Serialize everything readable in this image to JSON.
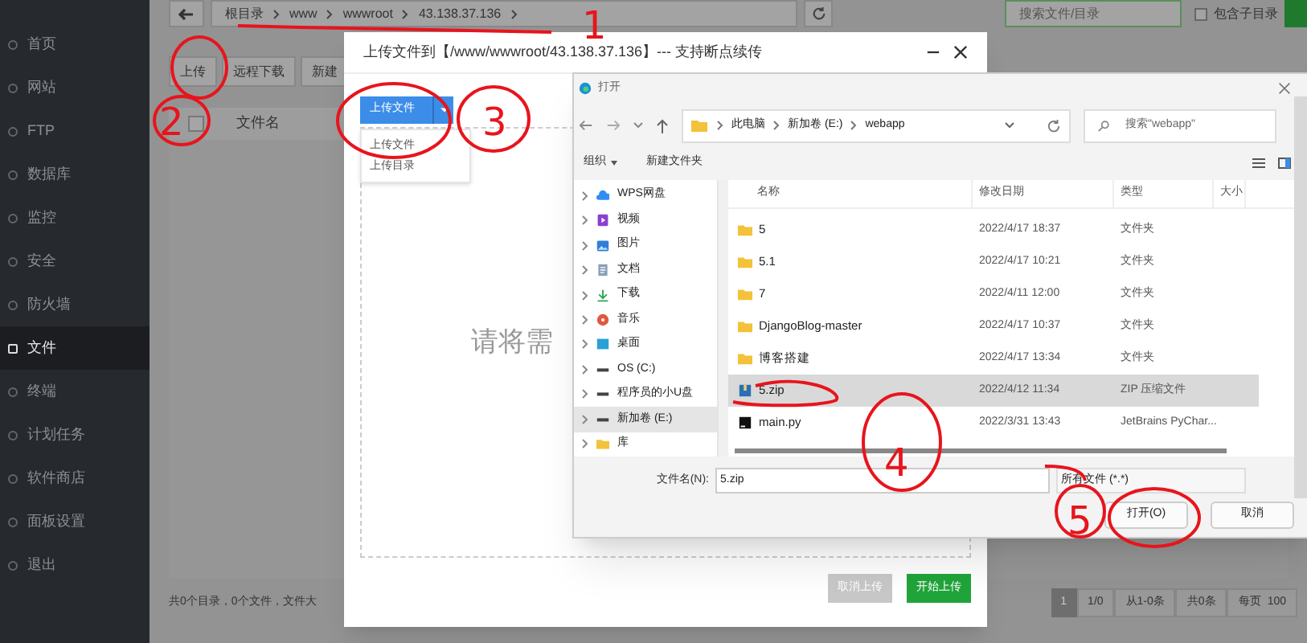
{
  "sidebar": {
    "items": [
      {
        "label": "首页",
        "selected": false
      },
      {
        "label": "网站",
        "selected": false
      },
      {
        "label": "FTP",
        "selected": false
      },
      {
        "label": "数据库",
        "selected": false
      },
      {
        "label": "监控",
        "selected": false
      },
      {
        "label": "安全",
        "selected": false
      },
      {
        "label": "防火墙",
        "selected": false
      },
      {
        "label": "文件",
        "selected": true
      },
      {
        "label": "终端",
        "selected": false
      },
      {
        "label": "计划任务",
        "selected": false
      },
      {
        "label": "软件商店",
        "selected": false
      },
      {
        "label": "面板设置",
        "selected": false
      },
      {
        "label": "退出",
        "selected": false
      }
    ]
  },
  "breadcrumb": [
    "根目录",
    "www",
    "wwwroot",
    "43.138.37.136"
  ],
  "search": {
    "placeholder": "搜索文件/目录"
  },
  "include_subdirs": {
    "label": "包含子目录",
    "checked": false
  },
  "toolbar": [
    "上传",
    "远程下载",
    "新建"
  ],
  "table": {
    "columns": [
      "文件名"
    ],
    "select_all": {
      "checked": false
    }
  },
  "footer": "共0个目录，0个文件，文件大",
  "pagination": {
    "current": "1",
    "items": [
      "1/0",
      "从1-0条",
      "共0条"
    ],
    "per_page_label": "每页",
    "per_page": "100"
  },
  "upload_dialog": {
    "title": "上传文件到【/www/wwwroot/43.138.37.136】--- 支持断点续传",
    "upload_button": "上传文件",
    "menu": [
      "上传文件",
      "上传目录"
    ],
    "drop_hint": "请将需",
    "buttons": [
      {
        "label": "取消上传",
        "kind": "secondary"
      },
      {
        "label": "开始上传",
        "kind": "primary"
      }
    ]
  },
  "open_dialog": {
    "title": "打开",
    "path": [
      "此电脑",
      "新加卷 (E:)",
      "webapp"
    ],
    "search": {
      "placeholder": "搜索\"webapp\""
    },
    "toolbar": [
      "组织",
      "新建文件夹"
    ],
    "nav": [
      {
        "label": "WPS网盘",
        "kind": "cloud",
        "selected": false
      },
      {
        "label": "视频",
        "kind": "video",
        "selected": false
      },
      {
        "label": "图片",
        "kind": "image",
        "selected": false
      },
      {
        "label": "文档",
        "kind": "document",
        "selected": false
      },
      {
        "label": "下载",
        "kind": "download",
        "selected": false
      },
      {
        "label": "音乐",
        "kind": "music",
        "selected": false
      },
      {
        "label": "桌面",
        "kind": "desktop",
        "selected": false
      },
      {
        "label": "OS (C:)",
        "kind": "drive",
        "selected": false
      },
      {
        "label": "程序员的小U盘",
        "kind": "drive",
        "selected": false
      },
      {
        "label": "新加卷 (E:)",
        "kind": "drive",
        "selected": true
      },
      {
        "label": "库",
        "kind": "folder",
        "selected": false
      }
    ],
    "columns": [
      "名称",
      "修改日期",
      "类型",
      "大小"
    ],
    "rows": [
      {
        "name": "5",
        "date": "2022/4/17 18:37",
        "type": "文件夹",
        "kind": "folder",
        "selected": false
      },
      {
        "name": "5.1",
        "date": "2022/4/17 10:21",
        "type": "文件夹",
        "kind": "folder",
        "selected": false
      },
      {
        "name": "7",
        "date": "2022/4/11 12:00",
        "type": "文件夹",
        "kind": "folder",
        "selected": false
      },
      {
        "name": "DjangoBlog-master",
        "date": "2022/4/17 10:37",
        "type": "文件夹",
        "kind": "folder",
        "selected": false
      },
      {
        "name": "博客搭建",
        "date": "2022/4/17 13:34",
        "type": "文件夹",
        "kind": "folder",
        "selected": false
      },
      {
        "name": "5.zip",
        "date": "2022/4/12 11:34",
        "type": "ZIP 压缩文件",
        "kind": "zip",
        "selected": true
      },
      {
        "name": "main.py",
        "date": "2022/3/31 13:43",
        "type": "JetBrains PyChar...",
        "kind": "script",
        "selected": false
      }
    ],
    "file_name_label": "文件名(N):",
    "file_name": "5.zip",
    "file_type": "所有文件 (*.*)",
    "buttons": [
      "打开(O)",
      "取消"
    ]
  },
  "annotations": [
    {
      "label": "1"
    },
    {
      "label": "2"
    },
    {
      "label": "3"
    },
    {
      "label": "4"
    },
    {
      "label": "5"
    }
  ]
}
